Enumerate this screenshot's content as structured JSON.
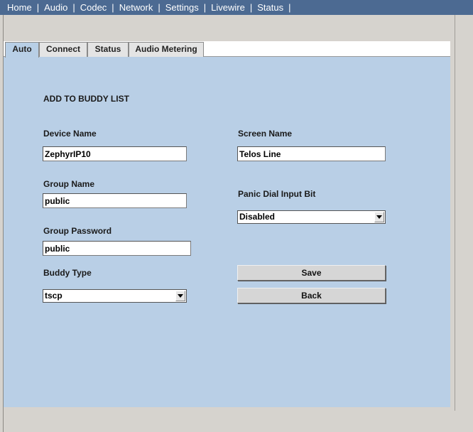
{
  "nav": {
    "items": [
      {
        "label": "Home"
      },
      {
        "label": "Audio"
      },
      {
        "label": "Codec"
      },
      {
        "label": "Network"
      },
      {
        "label": "Settings"
      },
      {
        "label": "Livewire"
      },
      {
        "label": "Status"
      }
    ],
    "separator": "|"
  },
  "tabs": [
    {
      "label": "Auto",
      "active": true
    },
    {
      "label": "Connect",
      "active": false
    },
    {
      "label": "Status",
      "active": false
    },
    {
      "label": "Audio Metering",
      "active": false
    }
  ],
  "form": {
    "heading": "ADD TO BUDDY LIST",
    "device_name": {
      "label": "Device Name",
      "value": "ZephyrIP10"
    },
    "screen_name": {
      "label": "Screen Name",
      "value": "Telos Line"
    },
    "group_name": {
      "label": "Group Name",
      "value": "public"
    },
    "panic_dial": {
      "label": "Panic Dial Input Bit",
      "value": "Disabled"
    },
    "group_password": {
      "label": "Group Password",
      "value": "public"
    },
    "buddy_type": {
      "label": "Buddy Type",
      "value": "tscp"
    },
    "save_label": "Save",
    "back_label": "Back"
  },
  "colors": {
    "nav_bg": "#4c6a92",
    "panel_bg": "#b9cfe6",
    "window_bg": "#d6d3ce"
  }
}
